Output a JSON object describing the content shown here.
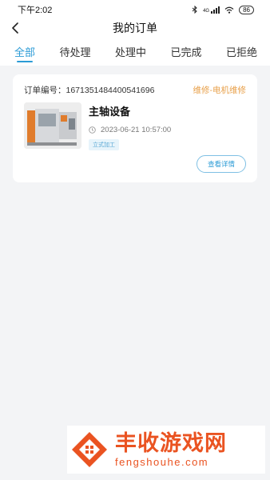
{
  "status_bar": {
    "time": "下午2:02",
    "signal_text": "4G",
    "battery": "86"
  },
  "nav": {
    "title": "我的订单"
  },
  "tabs": [
    {
      "label": "全部",
      "active": true
    },
    {
      "label": "待处理",
      "active": false
    },
    {
      "label": "处理中",
      "active": false
    },
    {
      "label": "已完成",
      "active": false
    },
    {
      "label": "已拒绝",
      "active": false
    }
  ],
  "order": {
    "number_label": "订单编号：",
    "number": "1671351484400541696",
    "type": "维修-电机维修",
    "device_name": "主轴设备",
    "time": "2023-06-21 10:57:00",
    "tag": "立式加工",
    "detail_button": "查看详情"
  },
  "watermark": {
    "cn": "丰收游戏网",
    "en": "fengshouhe.com"
  },
  "colors": {
    "accent": "#2b9bd6",
    "type_orange": "#e8a04a",
    "watermark": "#ea5321"
  },
  "icons": {
    "back": "chevron-left-icon",
    "clock": "clock-icon",
    "bluetooth": "bluetooth-icon",
    "wifi": "wifi-icon"
  }
}
